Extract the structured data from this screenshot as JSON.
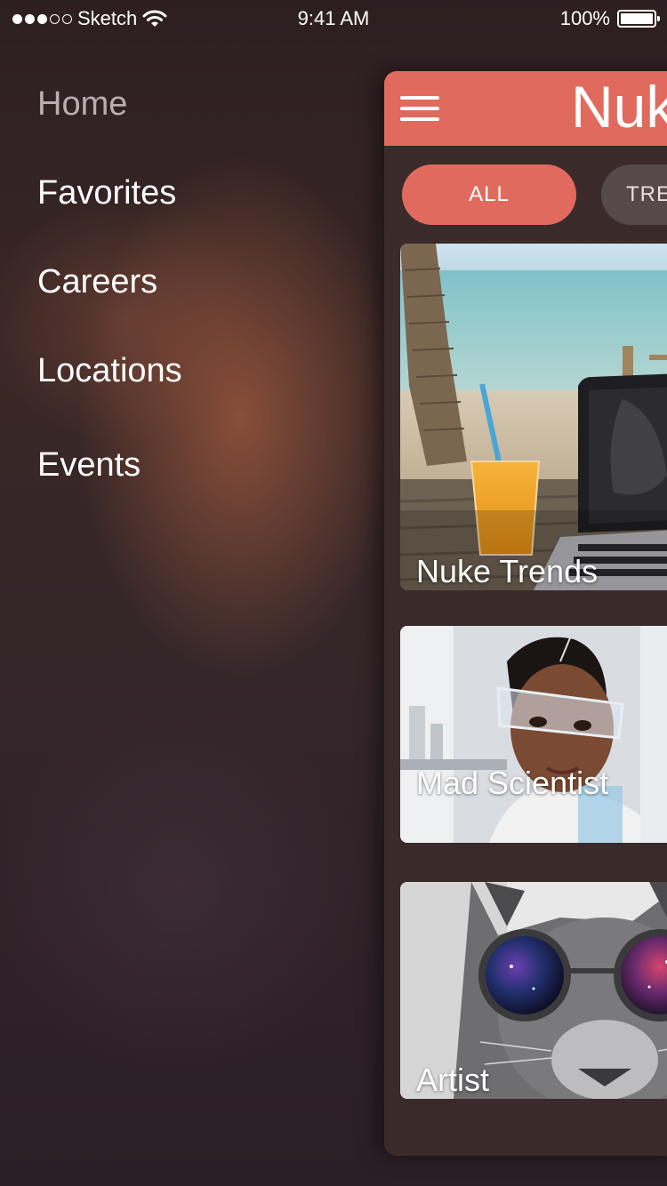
{
  "status_bar": {
    "carrier": "Sketch",
    "time": "9:41 AM",
    "battery": "100%"
  },
  "menu": {
    "items": [
      {
        "label": "Home"
      },
      {
        "label": "Favorites"
      },
      {
        "label": "Careers"
      },
      {
        "label": "Locations"
      },
      {
        "label": "Events"
      }
    ]
  },
  "panel": {
    "title": "Nuk",
    "filters": [
      {
        "label": "ALL"
      },
      {
        "label": "TRE"
      }
    ],
    "cards": [
      {
        "label": "Nuke Trends"
      },
      {
        "label": "Mad Scientist"
      },
      {
        "label": "Artist"
      }
    ]
  },
  "colors": {
    "accent": "#e06a5e",
    "panel": "#3a2a2a",
    "chip_inactive": "#56494a"
  }
}
